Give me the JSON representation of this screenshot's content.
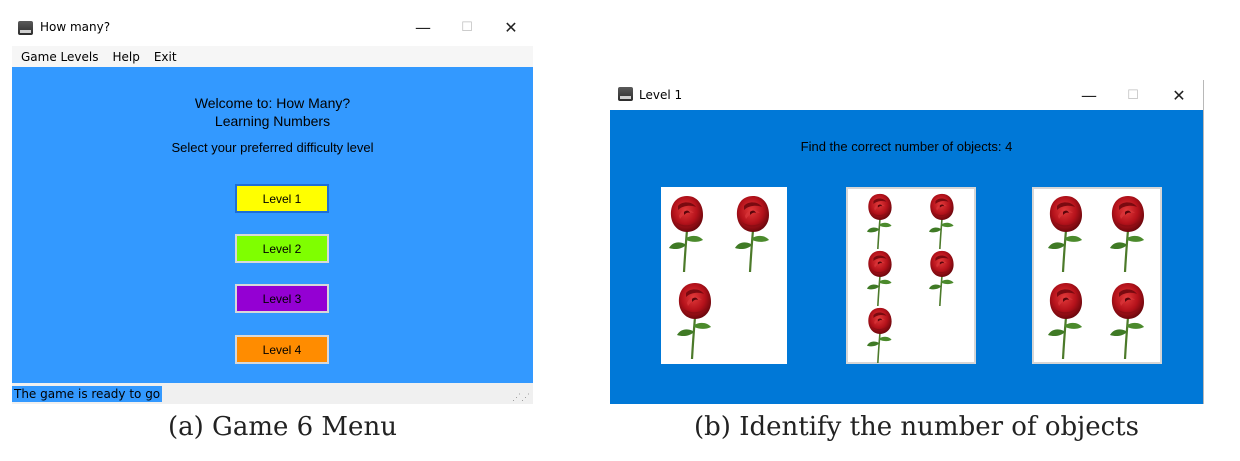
{
  "menu_window": {
    "title": "How many?",
    "controls": {
      "minimize": "—",
      "maximize": "☐",
      "close": "✕"
    },
    "menu": [
      "Game Levels",
      "Help",
      "Exit"
    ],
    "welcome": "Welcome to: How Many?",
    "subtitle": "Learning Numbers",
    "prompt": "Select your preferred difficulty level",
    "levels": [
      {
        "label": "Level 1",
        "color": "#ffff00"
      },
      {
        "label": "Level 2",
        "color": "#7fff00"
      },
      {
        "label": "Level 3",
        "color": "#9400d3"
      },
      {
        "label": "Level 4",
        "color": "#ff8c00"
      }
    ],
    "status": "The game is ready to go",
    "colors": {
      "background": "#3399ff"
    }
  },
  "level_window": {
    "title": "Level 1",
    "controls": {
      "minimize": "—",
      "maximize": "☐",
      "close": "✕"
    },
    "instruction": "Find the correct number of objects: 4",
    "cards": [
      {
        "rose_count": 3
      },
      {
        "rose_count": 5
      },
      {
        "rose_count": 4
      }
    ],
    "colors": {
      "background": "#0078d7"
    },
    "icons": [
      "rose-icon"
    ]
  },
  "captions": {
    "a": "(a) Game 6 Menu",
    "b": "(b) Identify the number of objects"
  }
}
